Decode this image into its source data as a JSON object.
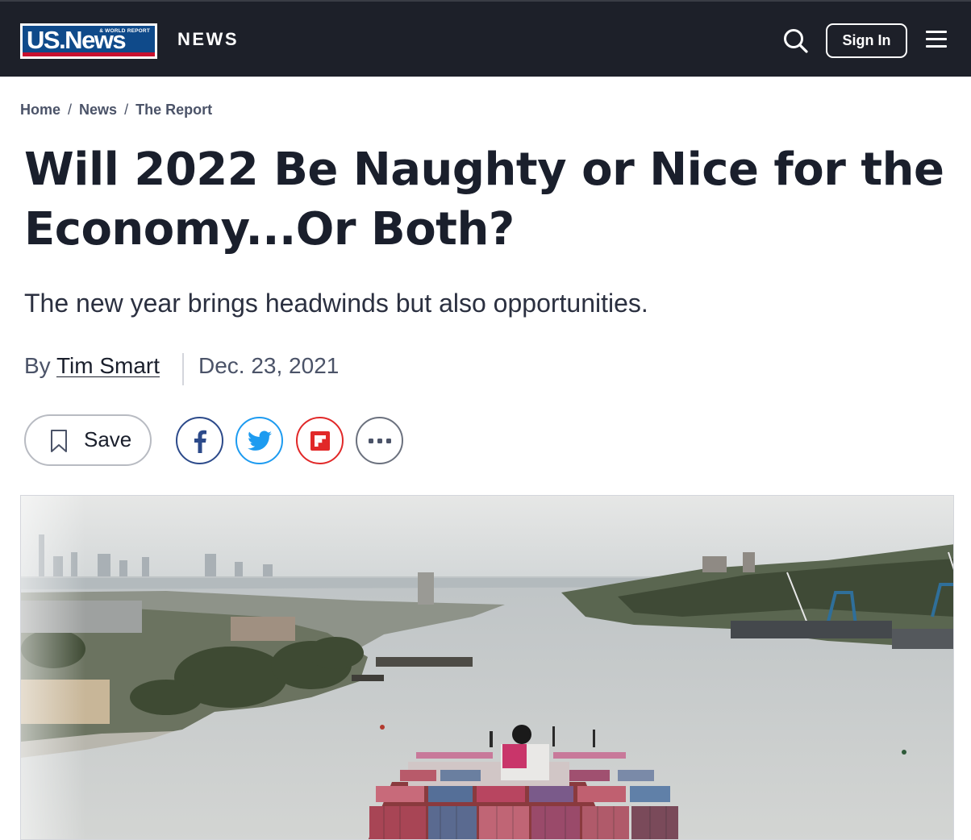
{
  "header": {
    "logo_main": "US.News",
    "logo_small": "& WORLD REPORT",
    "section": "NEWS",
    "signin_label": "Sign In"
  },
  "breadcrumb": {
    "items": [
      "Home",
      "News",
      "The Report"
    ],
    "separator": "/"
  },
  "article": {
    "headline_line1": "Will 2022 Be Naughty or Nice for the",
    "headline_line2": "Economy...Or Both?",
    "dek": "The new year brings headwinds but also opportunities.",
    "by_prefix": "By",
    "author": "Tim Smart",
    "date": "Dec. 23, 2021"
  },
  "actions": {
    "save_label": "Save",
    "share": [
      "facebook-icon",
      "twitter-icon",
      "flipboard-icon",
      "more-icon"
    ]
  },
  "colors": {
    "header_bg": "#1d2029",
    "logo_blue": "#0f4a8a",
    "logo_red": "#c8102e",
    "facebook": "#2c4a8a",
    "twitter": "#1d9bf0",
    "flipboard": "#e12828"
  },
  "hero_image": {
    "subject": "container-ship-harbor-photo"
  }
}
